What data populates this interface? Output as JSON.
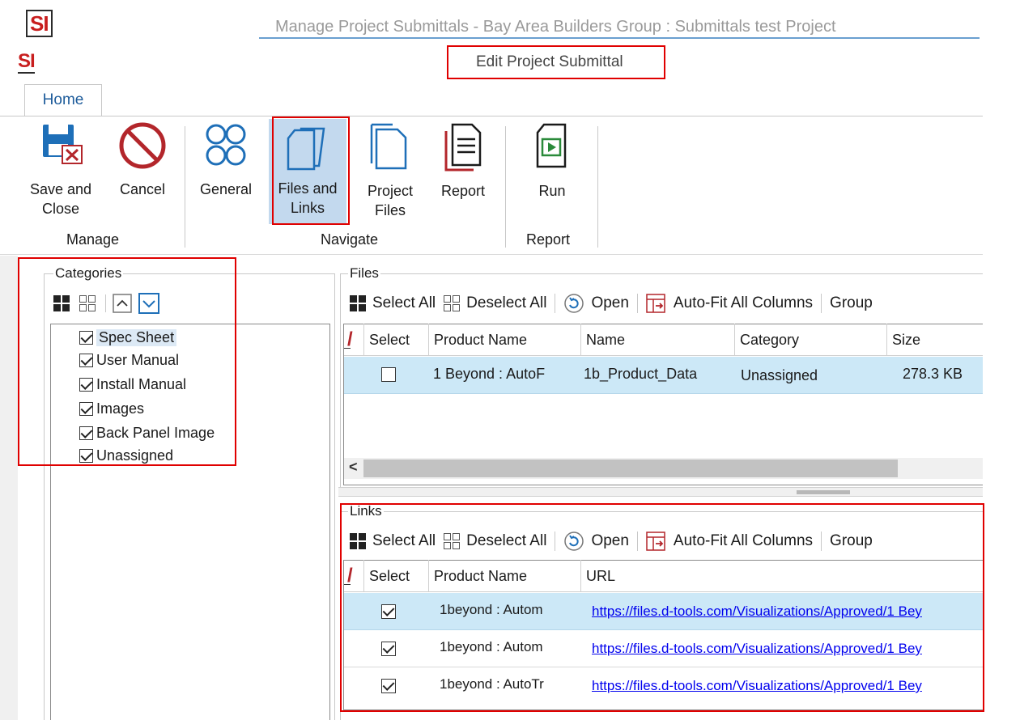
{
  "window": {
    "title": "Manage Project Submittals - Bay Area Builders Group : Submittals test Project",
    "logo_text": "SI",
    "dialog_title": "Edit Project Submittal"
  },
  "ribbon": {
    "tab": "Home",
    "groups": {
      "manage": "Manage",
      "navigate": "Navigate",
      "report": "Report"
    },
    "buttons": {
      "save_close_l1": "Save and",
      "save_close_l2": "Close",
      "cancel": "Cancel",
      "general": "General",
      "files_links_l1": "Files and",
      "files_links_l2": "Links",
      "project_files_l1": "Project",
      "project_files_l2": "Files",
      "report": "Report",
      "run": "Run"
    }
  },
  "categories": {
    "title": "Categories",
    "items": [
      {
        "label": "Spec Sheet",
        "checked": true
      },
      {
        "label": "User Manual",
        "checked": true
      },
      {
        "label": "Install Manual",
        "checked": true
      },
      {
        "label": "Images",
        "checked": true
      },
      {
        "label": "Back Panel Image",
        "checked": true
      },
      {
        "label": "Unassigned",
        "checked": true
      }
    ]
  },
  "files": {
    "title": "Files",
    "toolbar": {
      "select_all": "Select All",
      "deselect_all": "Deselect All",
      "open": "Open",
      "autofit": "Auto-Fit All Columns",
      "group": "Group"
    },
    "columns": [
      "Select",
      "Product Name",
      "Name",
      "Category",
      "Size"
    ],
    "rows": [
      {
        "checked": false,
        "product": "1 Beyond : AutoF",
        "name": "1b_Product_Data",
        "category": "Unassigned",
        "size": "278.3 KB"
      }
    ],
    "scroll_left": "<"
  },
  "links": {
    "title": "Links",
    "toolbar": {
      "select_all": "Select All",
      "deselect_all": "Deselect All",
      "open": "Open",
      "autofit": "Auto-Fit All Columns",
      "group": "Group"
    },
    "columns": [
      "Select",
      "Product Name",
      "URL"
    ],
    "rows": [
      {
        "checked": true,
        "product": "1beyond : Autom",
        "url": "https://files.d-tools.com/Visualizations/Approved/1 Bey"
      },
      {
        "checked": true,
        "product": "1beyond : Autom",
        "url": "https://files.d-tools.com/Visualizations/Approved/1 Bey"
      },
      {
        "checked": true,
        "product": "1beyond : AutoTr",
        "url": "https://files.d-tools.com/Visualizations/Approved/1 Bey"
      }
    ]
  },
  "colors": {
    "accent_red": "#e00000",
    "selection_blue": "#cce8f7",
    "ribbon_blue": "#1e6fb8",
    "icon_red": "#b3262b"
  }
}
